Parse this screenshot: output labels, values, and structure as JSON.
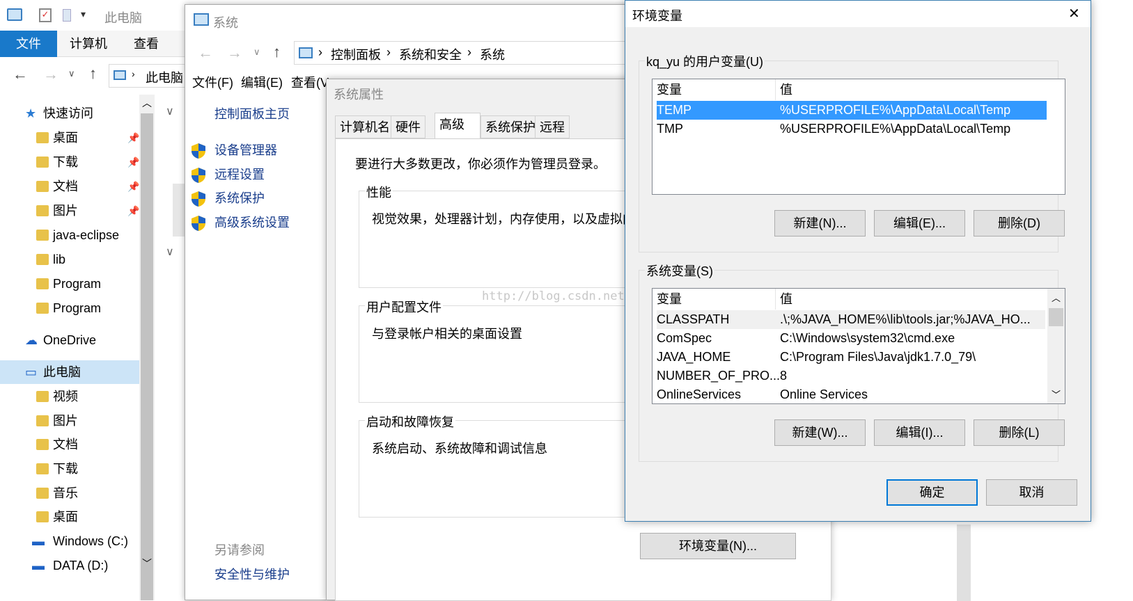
{
  "explorer": {
    "title": "此电脑",
    "ribbon_tabs": [
      "文件",
      "计算机",
      "查看"
    ],
    "address": "此电脑",
    "nav": [
      {
        "label": "快速访问",
        "icon": "star-icon",
        "pinned": false
      },
      {
        "label": "桌面",
        "icon": "folder-icon",
        "pinned": true
      },
      {
        "label": "下载",
        "icon": "folder-icon",
        "pinned": true
      },
      {
        "label": "文档",
        "icon": "folder-icon",
        "pinned": true
      },
      {
        "label": "图片",
        "icon": "folder-icon",
        "pinned": true
      },
      {
        "label": "java-eclipse",
        "icon": "folder-icon",
        "pinned": false
      },
      {
        "label": "lib",
        "icon": "folder-icon",
        "pinned": false
      },
      {
        "label": "Program",
        "icon": "folder-icon",
        "pinned": false
      },
      {
        "label": "Program",
        "icon": "folder-icon",
        "pinned": false
      },
      {
        "label": "OneDrive",
        "icon": "cloud-icon",
        "pinned": false
      },
      {
        "label": "此电脑",
        "icon": "computer-icon",
        "pinned": false,
        "selected": true
      },
      {
        "label": "视频",
        "icon": "folder-icon",
        "pinned": false
      },
      {
        "label": "图片",
        "icon": "folder-icon",
        "pinned": false
      },
      {
        "label": "文档",
        "icon": "folder-icon",
        "pinned": false
      },
      {
        "label": "下载",
        "icon": "folder-icon",
        "pinned": false
      },
      {
        "label": "音乐",
        "icon": "folder-icon",
        "pinned": false
      },
      {
        "label": "桌面",
        "icon": "folder-icon",
        "pinned": false
      },
      {
        "label": "Windows (C:)",
        "icon": "drive-icon",
        "pinned": false
      },
      {
        "label": "DATA (D:)",
        "icon": "drive-icon",
        "pinned": false
      }
    ]
  },
  "system": {
    "title": "系统",
    "breadcrumb": [
      "控制面板",
      "系统和安全",
      "系统"
    ],
    "menu": [
      "文件(F)",
      "编辑(E)",
      "查看(V"
    ],
    "home_link": "控制面板主页",
    "links": [
      "设备管理器",
      "远程设置",
      "系统保护",
      "高级系统设置"
    ],
    "see_also": "另请参阅",
    "see_also_link": "安全性与维护"
  },
  "props": {
    "title": "系统属性",
    "tabs": [
      "计算机名",
      "硬件",
      "高级",
      "系统保护",
      "远程"
    ],
    "admin_note": "要进行大多数更改，你必须作为管理员登录。",
    "perf_title": "性能",
    "perf_desc": "视觉效果，处理器计划，内存使用，以及虚拟内存",
    "profile_title": "用户配置文件",
    "profile_desc": "与登录帐户相关的桌面设置",
    "startup_title": "启动和故障恢复",
    "startup_desc": "系统启动、系统故障和调试信息",
    "watermark": "http://blog.csdn.net/",
    "env_button": "环境变量(N)..."
  },
  "env": {
    "title": "环境变量",
    "user_group": "kq_yu 的用户变量(U)",
    "col_var": "变量",
    "col_val": "值",
    "user_vars": [
      {
        "name": "TEMP",
        "value": "%USERPROFILE%\\AppData\\Local\\Temp",
        "selected": true
      },
      {
        "name": "TMP",
        "value": "%USERPROFILE%\\AppData\\Local\\Temp",
        "selected": false
      }
    ],
    "user_buttons": [
      "新建(N)...",
      "编辑(E)...",
      "删除(D)"
    ],
    "sys_group": "系统变量(S)",
    "sys_vars": [
      {
        "name": "CLASSPATH",
        "value": ".\\;%JAVA_HOME%\\lib\\tools.jar;%JAVA_HO..."
      },
      {
        "name": "ComSpec",
        "value": "C:\\Windows\\system32\\cmd.exe"
      },
      {
        "name": "JAVA_HOME",
        "value": "C:\\Program Files\\Java\\jdk1.7.0_79\\"
      },
      {
        "name": "NUMBER_OF_PRO...",
        "value": "8"
      },
      {
        "name": "OnlineServices",
        "value": "Online Services"
      }
    ],
    "sys_buttons": [
      "新建(W)...",
      "编辑(I)...",
      "删除(L)"
    ],
    "ok": "确定",
    "cancel": "取消",
    "close_glyph": "✕"
  },
  "colors": {
    "accent": "#0078d7",
    "selection": "#3399ff",
    "link": "#1a3e8c"
  }
}
